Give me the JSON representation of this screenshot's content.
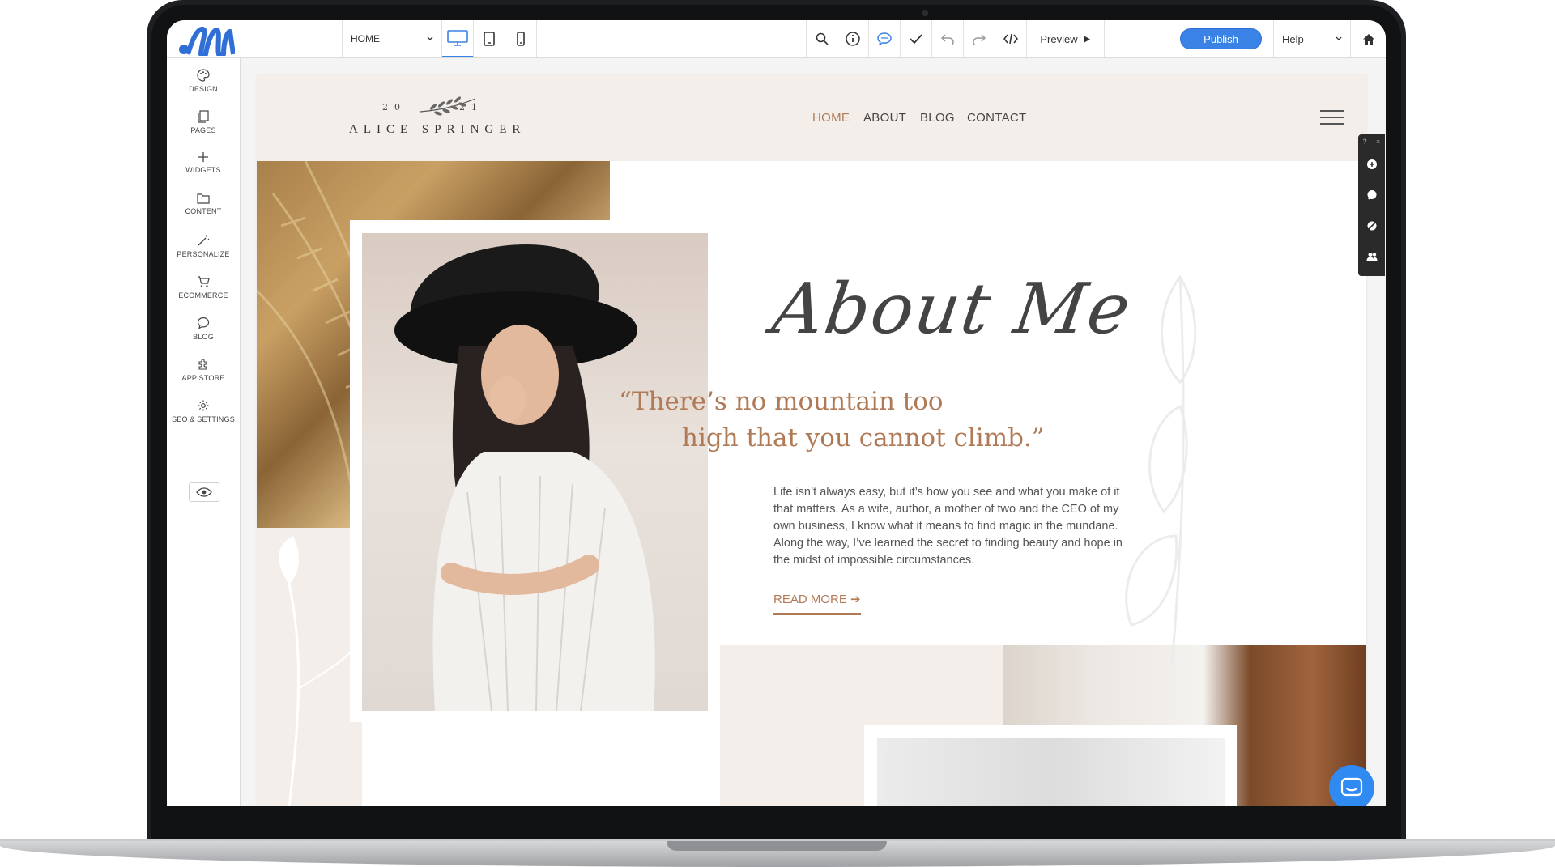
{
  "toolbar": {
    "page_select": "HOME",
    "preview_label": "Preview",
    "publish_label": "Publish",
    "help_label": "Help",
    "icons": [
      "desktop-view-icon",
      "tablet-view-icon",
      "mobile-view-icon",
      "search-icon",
      "info-icon",
      "comments-icon",
      "check-icon",
      "undo-icon",
      "redo-icon",
      "code-icon",
      "play-icon",
      "home-icon"
    ]
  },
  "sidebar": {
    "items": [
      {
        "label": "DESIGN",
        "icon": "palette-icon"
      },
      {
        "label": "PAGES",
        "icon": "pages-icon"
      },
      {
        "label": "WIDGETS",
        "icon": "plus-icon"
      },
      {
        "label": "CONTENT",
        "icon": "folder-icon"
      },
      {
        "label": "PERSONALIZE",
        "icon": "wand-icon"
      },
      {
        "label": "ECOMMERCE",
        "icon": "cart-icon"
      },
      {
        "label": "BLOG",
        "icon": "speech-bubble-icon"
      },
      {
        "label": "APP STORE",
        "icon": "puzzle-icon"
      },
      {
        "label": "SEO & SETTINGS",
        "icon": "gear-icon"
      }
    ]
  },
  "site": {
    "brand_year_left": "20",
    "brand_year_right": "21",
    "brand_name": "ALICE SPRINGER",
    "nav": [
      "HOME",
      "ABOUT",
      "BLOG",
      "CONTACT"
    ],
    "active_nav": "HOME",
    "about_title": "About Me",
    "quote_line1": "“There’s no mountain too",
    "quote_line2": "high that you cannot climb.”",
    "body": "Life isn’t always easy, but it’s how you see and what you make of it that matters. As a wife, author, a mother of two and the CEO of my own business, I know what it means to find magic in the mundane. Along the way, I’ve learned the secret to finding beauty and hope in the midst of impossible circumstances.",
    "read_more": "READ MORE ➔"
  },
  "colors": {
    "accent": "#b07a56",
    "header_bg": "#f3eeea",
    "publish": "#3b82e6",
    "editor_logo": "#2f6fd6"
  }
}
